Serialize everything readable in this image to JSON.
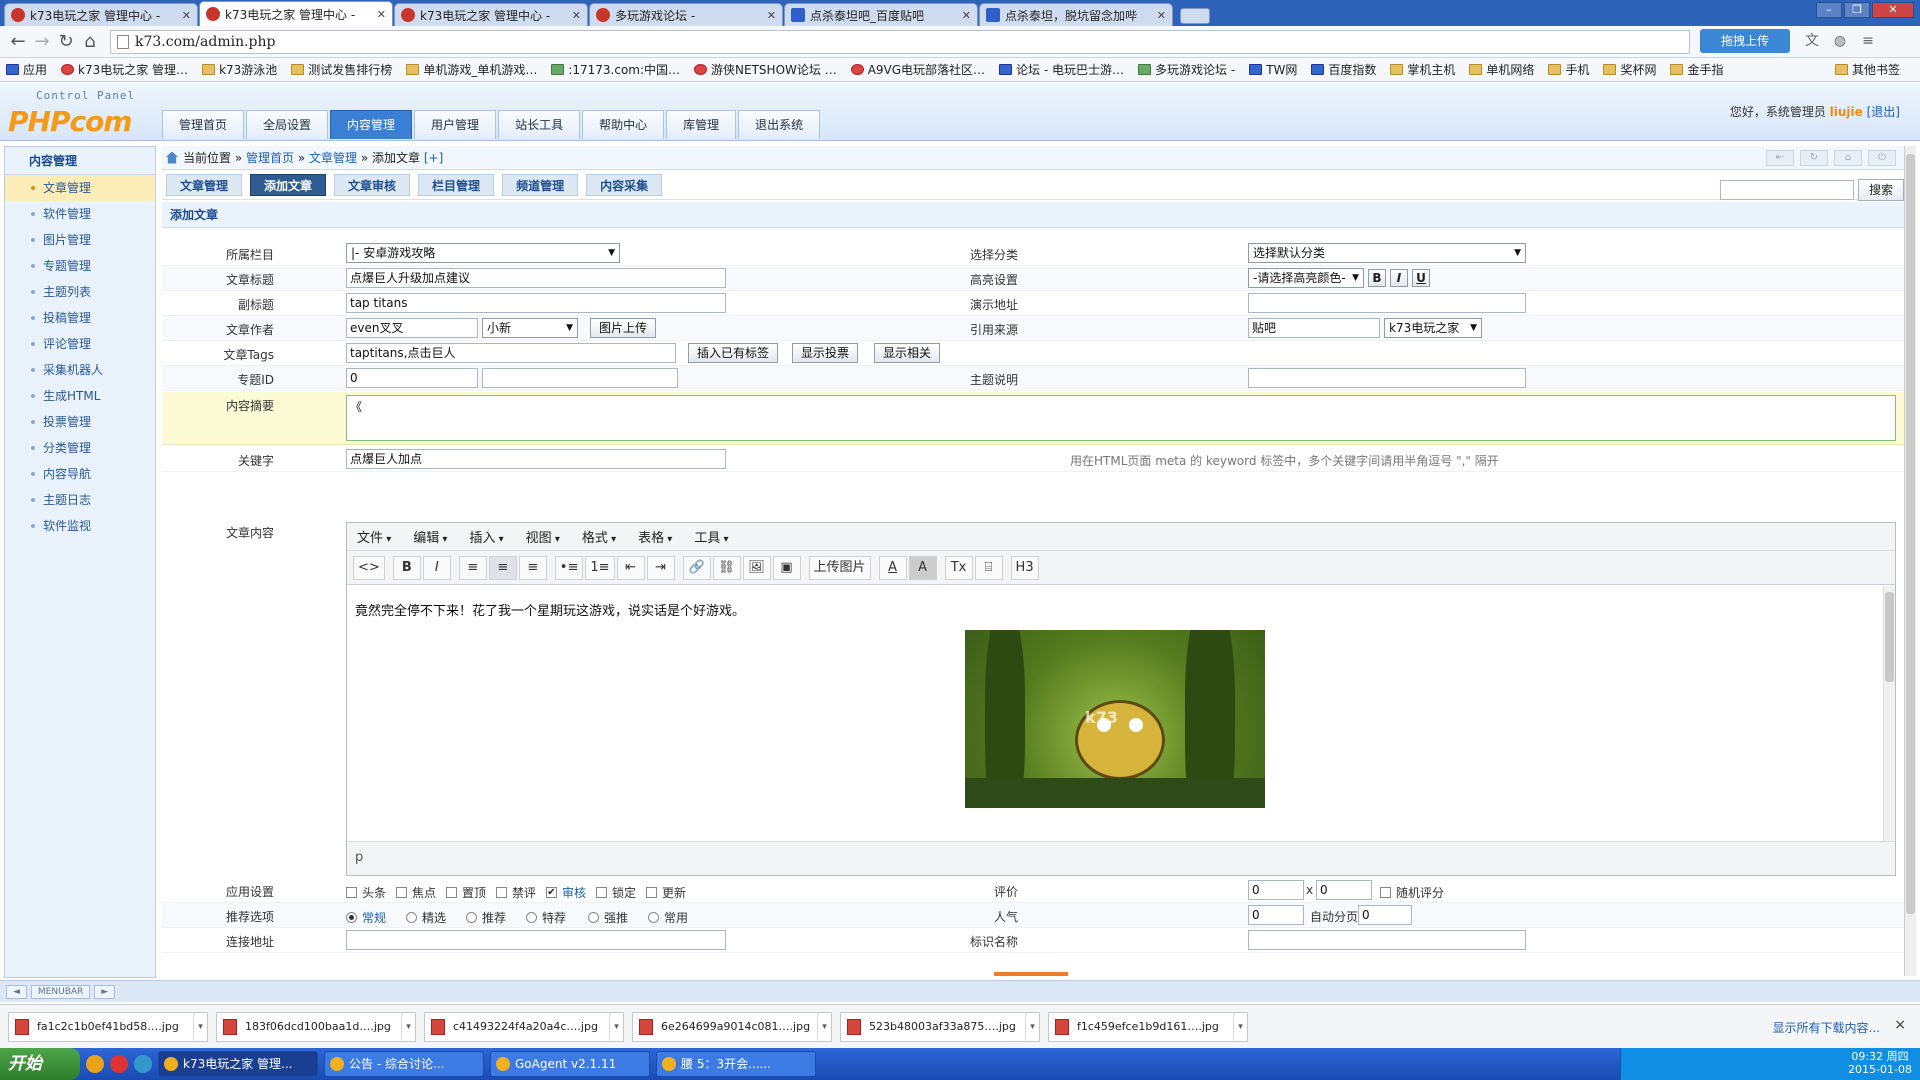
{
  "browser": {
    "tabs": [
      {
        "title": "k73电玩之家 管理中心 -",
        "active": false
      },
      {
        "title": "k73电玩之家 管理中心 -",
        "active": true
      },
      {
        "title": "k73电玩之家 管理中心 -",
        "active": false
      },
      {
        "title": "多玩游戏论坛 -",
        "active": false
      },
      {
        "title": "点杀泰坦吧_百度贴吧",
        "active": false
      },
      {
        "title": "点杀泰坦，脱坑留念加哔",
        "active": false
      }
    ],
    "url": "k73.com/admin.php",
    "upload_label": "拖拽上传",
    "bookmarks": [
      "应用",
      "k73电玩之家 管理…",
      "k73游泳池",
      "测试发售排行榜",
      "单机游戏_单机游戏…",
      ":17173.com:中国…",
      "游侠NETSHOW论坛 …",
      "A9VG电玩部落社区…",
      "论坛 - 电玩巴士游…",
      "多玩游戏论坛 -",
      "TW网",
      "百度指数",
      "掌机主机",
      "单机网络",
      "手机",
      "奖杯网",
      "金手指",
      "其他书签"
    ]
  },
  "header": {
    "control_panel": "Control Panel",
    "logo": "PHPcom",
    "nav": [
      "管理首页",
      "全局设置",
      "内容管理",
      "用户管理",
      "站长工具",
      "帮助中心",
      "库管理",
      "退出系统"
    ],
    "active_nav": "内容管理",
    "greeting": "您好，系统管理员",
    "username": "liujie",
    "logout": "[退出]"
  },
  "sidebar": {
    "title": "内容管理",
    "items": [
      "文章管理",
      "软件管理",
      "图片管理",
      "专题管理",
      "主题列表",
      "投稿管理",
      "评论管理",
      "采集机器人",
      "生成HTML",
      "投票管理",
      "分类管理",
      "内容导航",
      "主题日志",
      "软件监视"
    ],
    "active": "文章管理"
  },
  "breadcrumb": {
    "current": "当前位置",
    "path": [
      "管理首页",
      "文章管理",
      "添加文章"
    ],
    "add": "[+]"
  },
  "subnav": [
    "文章管理",
    "添加文章",
    "文章审核",
    "栏目管理",
    "频道管理",
    "内容采集"
  ],
  "search_button": "搜索",
  "section_title": "添加文章",
  "form": {
    "category_label": "所属栏目",
    "category_value": "|- 安卓游戏攻略",
    "classify_label": "选择分类",
    "classify_value": "选择默认分类",
    "title_label": "文章标题",
    "title_value": "点爆巨人升级加点建议",
    "highlight_label": "高亮设置",
    "highlight_value": "-请选择高亮颜色-",
    "fmt_b": "B",
    "fmt_i": "I",
    "fmt_u": "U",
    "subtitle_label": "副标题",
    "subtitle_value": "tap titans",
    "demo_label": "演示地址",
    "demo_value": "",
    "author_label": "文章作者",
    "author_value": "even叉叉",
    "editor_value": "小新",
    "img_upload": "图片上传",
    "source_label": "引用来源",
    "source_value": "贴吧",
    "source_select": "k73电玩之家",
    "tags_label": "文章Tags",
    "tags_value": "taptitans,点击巨人",
    "insert_tags": "插入已有标签",
    "show_vote": "显示投票",
    "show_related": "显示相关",
    "topic_label": "专题ID",
    "topic_value": "0",
    "topic_value2": "",
    "theme_desc_label": "主题说明",
    "theme_desc_value": "",
    "summary_label": "内容摘要",
    "summary_value": "《",
    "keywords_label": "关键字",
    "keywords_value": "点爆巨人加点",
    "keywords_hint": "用在HTML页面 meta 的 keyword 标签中，多个关键字间请用半角逗号 \",\" 隔开",
    "content_label": "文章内容",
    "apply_label": "应用设置",
    "apply_options": [
      {
        "label": "头条",
        "checked": false
      },
      {
        "label": "焦点",
        "checked": false
      },
      {
        "label": "置顶",
        "checked": false
      },
      {
        "label": "禁评",
        "checked": false
      },
      {
        "label": "审核",
        "checked": true
      },
      {
        "label": "锁定",
        "checked": false
      },
      {
        "label": "更新",
        "checked": false
      }
    ],
    "rating_label": "评价",
    "rating_a": "0",
    "rating_x": "x",
    "rating_b": "0",
    "random_rating": "随机评分",
    "recommend_label": "推荐选项",
    "recommend_options": [
      {
        "label": "常规",
        "checked": true
      },
      {
        "label": "精选",
        "checked": false
      },
      {
        "label": "推荐",
        "checked": false
      },
      {
        "label": "特荐",
        "checked": false
      },
      {
        "label": "强推",
        "checked": false
      },
      {
        "label": "常用",
        "checked": false
      }
    ],
    "popularity_label": "人气",
    "popularity_value": "0",
    "autopage_label": "自动分页",
    "autopage_value": "0",
    "link_label": "连接地址",
    "link_value": "",
    "mark_label": "标识名称",
    "mark_value": ""
  },
  "editor": {
    "menu": [
      "文件",
      "编辑",
      "插入",
      "视图",
      "格式",
      "表格",
      "工具"
    ],
    "toolbar": [
      "<>",
      "B",
      "I",
      "≡",
      "≡",
      "≡",
      "•≡",
      "1≡",
      "⇤",
      "⇥",
      "🔗",
      "⛓",
      "🖼",
      "▣",
      "上传图片",
      "A",
      "A",
      "Tx",
      "⌸",
      "H3"
    ],
    "body_text": "竟然完全停不下来！花了我一个星期玩这游戏，说实话是个好游戏。",
    "image_watermark": "k73",
    "status_path": "p"
  },
  "framebar": "MENUBAR",
  "downloads": {
    "items": [
      "fa1c2c1b0ef41bd58….jpg",
      "183f06dcd100baa1d….jpg",
      "c41493224f4a20a4c….jpg",
      "6e264699a9014c081….jpg",
      "523b48003af33a875….jpg",
      "f1c459efce1b9d161….jpg"
    ],
    "show_all": "显示所有下载内容...",
    "close": "×"
  },
  "taskbar": {
    "start": "开始",
    "tasks": [
      "k73电玩之家 管理...",
      "公告 - 综合讨论...",
      "GoAgent v2.1.11",
      "腰  5：3开会......"
    ],
    "time": "09:32 周四",
    "date": "2015-01-08"
  }
}
